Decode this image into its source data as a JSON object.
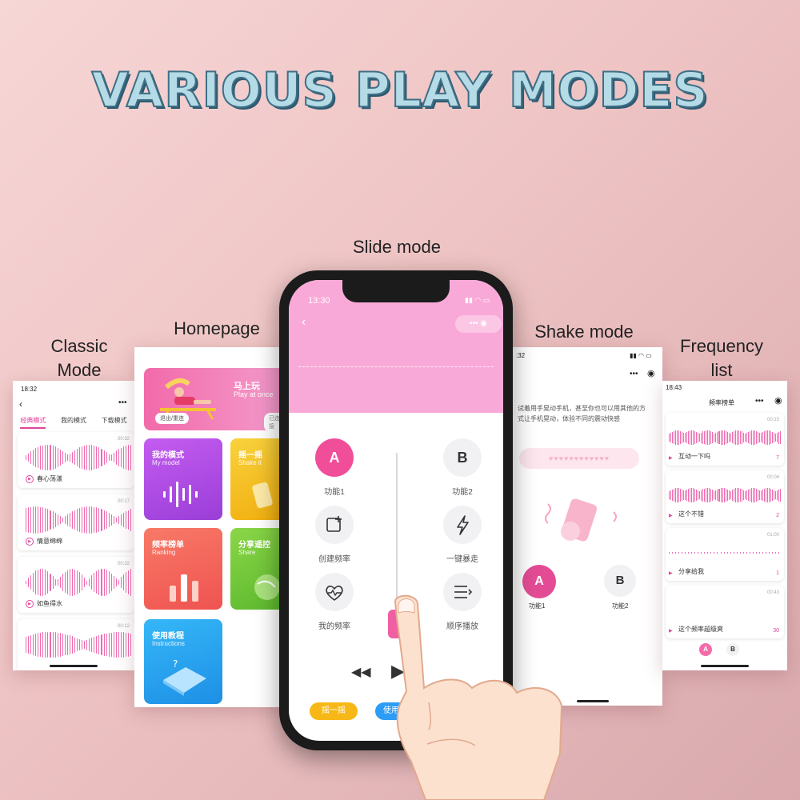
{
  "title": "VARIOUS PLAY MODES",
  "labels": {
    "classic": "Classic\nMode",
    "homepage": "Homepage",
    "slide": "Slide mode",
    "shake": "Shake mode",
    "frequency": "Frequency\nlist"
  },
  "classic": {
    "time": "18:32",
    "tabs": [
      "经典模式",
      "我的模式",
      "下载模式"
    ],
    "items": [
      {
        "name": "春心荡漾",
        "time": "00:32"
      },
      {
        "name": "情意绵绵",
        "time": "00:17"
      },
      {
        "name": "如鱼得水",
        "time": "00:32"
      },
      {
        "name": "",
        "time": "00:12"
      }
    ]
  },
  "home": {
    "banner_title": "马上玩",
    "banner_sub": "Play at once",
    "exit_label": "退出/重连",
    "connected_label": "已连接",
    "tiles": [
      {
        "title": "我的模式",
        "sub": "My model"
      },
      {
        "title": "摇一摇",
        "sub": "Shake it"
      },
      {
        "title": "频率榜单",
        "sub": "Ranking"
      },
      {
        "title": "分享遥控",
        "sub": "Share"
      },
      {
        "title": "使用教程",
        "sub": "Instructions"
      }
    ]
  },
  "slide": {
    "time": "13:30",
    "btn_a": "A",
    "btn_b": "B",
    "func1": "功能1",
    "func2": "功能2",
    "create": "创建频率",
    "burst": "一键暴走",
    "mine": "我的频率",
    "order": "顺序播放",
    "shake_btn": "摇一摇",
    "tutorial_btn": "使用教程"
  },
  "shake": {
    "time": ":32",
    "desc": "试着用手晃动手机，甚至你也可以用其他的方式让手机晃动，体验不同的震动快感",
    "btn_a": "A",
    "btn_b": "B",
    "func1": "功能1",
    "func2": "功能2"
  },
  "freq": {
    "time": "18:43",
    "title": "频率榜单",
    "items": [
      {
        "name": "互动一下吗",
        "time": "00:15",
        "count": "7"
      },
      {
        "name": "这个不错",
        "time": "00:04",
        "count": "2"
      },
      {
        "name": "分享给我",
        "time": "01:00",
        "count": "1"
      },
      {
        "name": "这个频率超级爽",
        "time": "00:43",
        "count": "30"
      }
    ],
    "btn_a": "A",
    "btn_b": "B"
  },
  "colors": {
    "accent_pink": "#e2469c",
    "wave_pink": "#ee6ab0",
    "slide_top": "#f9a9d8",
    "tile_mymodel": "#b24ee6",
    "tile_shake": "#f5c21b",
    "tile_ranking": "#f4685a",
    "tile_share": "#6cc53a",
    "tile_instructions": "#2aa6f0",
    "shake_pill": "#f7b716",
    "tutorial_pill": "#2d9cf5"
  }
}
